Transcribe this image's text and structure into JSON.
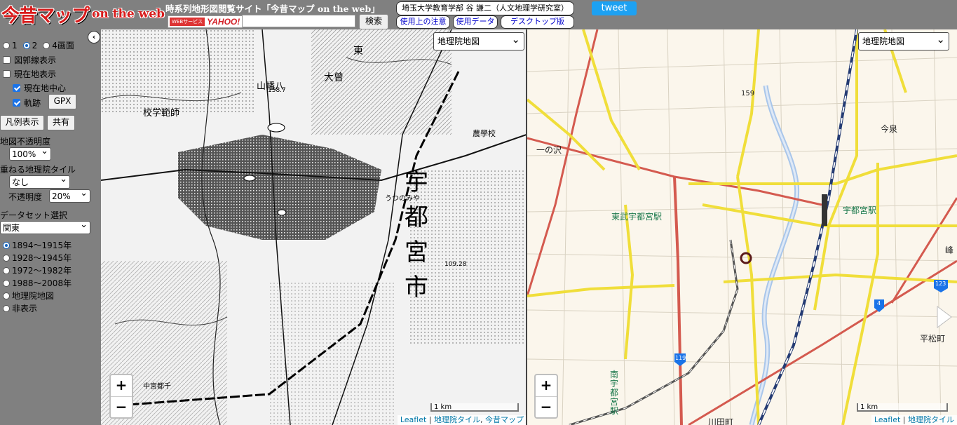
{
  "header": {
    "logo_jp": "今昔マップ",
    "logo_en": "on the web",
    "site_title": "時系列地形図閲覧サイト「今昔マップ on the web」",
    "yahoo_small": "WEBサービス",
    "yahoo_big": "YAHOO!",
    "search_value": "",
    "search_button": "検索",
    "credit": "埼玉大学教育学部 谷 謙二（人文地理学研究室）",
    "links": [
      "使用上の注意",
      "使用データ",
      "デスクトップ版"
    ],
    "tweet": "tweet"
  },
  "sidebar": {
    "collapse": "‹",
    "screens": [
      {
        "label": "1",
        "selected": false
      },
      {
        "label": "2",
        "selected": true
      },
      {
        "label": "4画面",
        "selected": false
      }
    ],
    "checkboxes": {
      "grid_lines": {
        "label": "図郭線表示",
        "checked": false
      },
      "current_location": {
        "label": "現在地表示",
        "checked": false
      },
      "center_current": {
        "label": "現在地中心",
        "checked": true
      },
      "track": {
        "label": "軌跡",
        "checked": true
      }
    },
    "gpx_button": "GPX",
    "legend_button": "凡例表示",
    "share_button": "共有",
    "opacity_label": "地図不透明度",
    "opacity_value": "100%",
    "overlay_label": "重ねる地理院タイル",
    "overlay_value": "なし",
    "overlay_opacity_label": "不透明度",
    "overlay_opacity_value": "20%",
    "dataset_label": "データセット選択",
    "dataset_value": "関東",
    "periods": [
      {
        "label": "1894～1915年",
        "selected": true
      },
      {
        "label": "1928～1945年",
        "selected": false
      },
      {
        "label": "1972～1982年",
        "selected": false
      },
      {
        "label": "1988～2008年",
        "selected": false
      },
      {
        "label": "地理院地図",
        "selected": false
      },
      {
        "label": "非表示",
        "selected": false
      }
    ]
  },
  "left_map": {
    "layer_select": "地理院地図",
    "zoom_in": "+",
    "zoom_out": "−",
    "scale": "1 km",
    "attribution": [
      "Leaflet",
      "地理院タイル",
      "今昔マップ"
    ],
    "labels": {
      "utsunomiya_1": "宇",
      "utsunomiya_2": "都",
      "utsunomiya_3": "宮",
      "utsunomiya_4": "市",
      "kana": "うつのみや",
      "east": "東",
      "school": "校学範師",
      "hachiman": "山幡八",
      "ohsone": "大曾",
      "elev": "158.7",
      "elev2": "109.28",
      "agri": "農學校",
      "nakamiya": "中宮都千"
    }
  },
  "right_map": {
    "layer_select": "地理院地図",
    "zoom_in": "+",
    "zoom_out": "−",
    "scale": "1 km",
    "attribution": [
      "Leaflet",
      "地理院タイル"
    ],
    "labels": {
      "ichinosawa": "一の沢",
      "imaizumi": "今泉",
      "tobu_station": "東武宇都宮駅",
      "jr_station": "宇都宮駅",
      "hiramatsu": "平松町",
      "kawada": "川田町",
      "minami_station": "南宇都宮駅",
      "mine": "峰",
      "elev": "159",
      "route119": "119",
      "route4": "4",
      "route123": "123"
    }
  }
}
